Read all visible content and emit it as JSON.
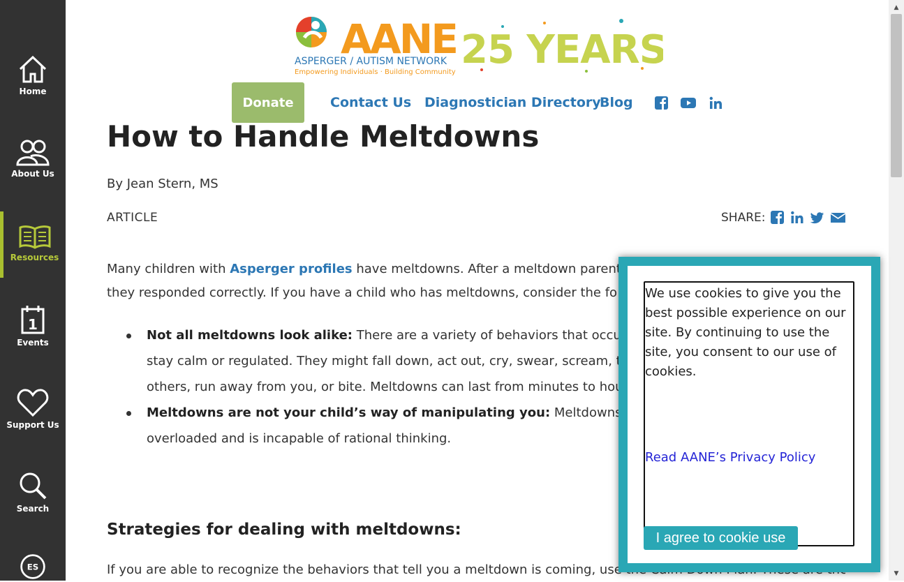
{
  "sidebar": {
    "items": [
      {
        "label": "Home",
        "icon": "home-icon"
      },
      {
        "label": "About Us",
        "icon": "people-icon"
      },
      {
        "label": "Resources",
        "icon": "book-icon"
      },
      {
        "label": "Events",
        "icon": "calendar-icon"
      },
      {
        "label": "Support Us",
        "icon": "heart-icon"
      },
      {
        "label": "Search",
        "icon": "search-icon"
      },
      {
        "label": "ES",
        "icon": "language-icon"
      }
    ],
    "active_color": "#b6c93a",
    "bg_color": "#323232"
  },
  "header": {
    "logo_name": "AANE",
    "logo_sub": "ASPERGER / AUTISM NETWORK",
    "logo_tagline": "Empowering Individuals · Building Community",
    "logo_years": "25 YEARS",
    "donate_label": "Donate",
    "nav": [
      "Contact Us",
      "Diagnostician Directory",
      "Blog"
    ],
    "social_icons": [
      "facebook-icon",
      "youtube-icon",
      "linkedin-icon"
    ],
    "link_color": "#2c77b4",
    "donate_color": "#9bbb6c"
  },
  "article": {
    "title": "How to Handle Meltdowns",
    "byline": "By Jean Stern, MS",
    "kind": "ARTICLE",
    "share_label": "SHARE:",
    "share_icons": [
      "facebook-icon",
      "linkedin-icon",
      "twitter-icon",
      "email-icon"
    ],
    "intro_prefix": "Many children with ",
    "intro_link": "Asperger profiles",
    "intro_rest": " have meltdowns. After a meltdown parents",
    "intro_line2": "they responded correctly. If you have a child who has meltdowns, consider the fo",
    "bullets": [
      {
        "lead": "Not all meltdowns look alike:",
        "text": " There are a variety of behaviors that occur w",
        "line2": "stay calm or regulated. They might fall down, act out, cry, swear, scream, th",
        "line3": "others, run away from you, or bite. Meltdowns can last from minutes to hou"
      },
      {
        "lead": "Meltdowns are not your child’s way of manipulating you:",
        "text": " Meltdowns are em",
        "line2": "overloaded and is incapable of rational thinking."
      }
    ],
    "strategies_heading": "Strategies for dealing with meltdowns:",
    "strategies_text": "If you are able to recognize the behaviors that tell you a meltdown is coming, use the Calm Down Plan. These are the"
  },
  "cookie": {
    "message": "We use cookies to give you the best possible experience on our site. By continuing to use the site, you consent to our use of cookies.",
    "link": "Read AANE’s Privacy Policy",
    "button": "I agree to cookie use",
    "accent": "#2aa7b5"
  }
}
